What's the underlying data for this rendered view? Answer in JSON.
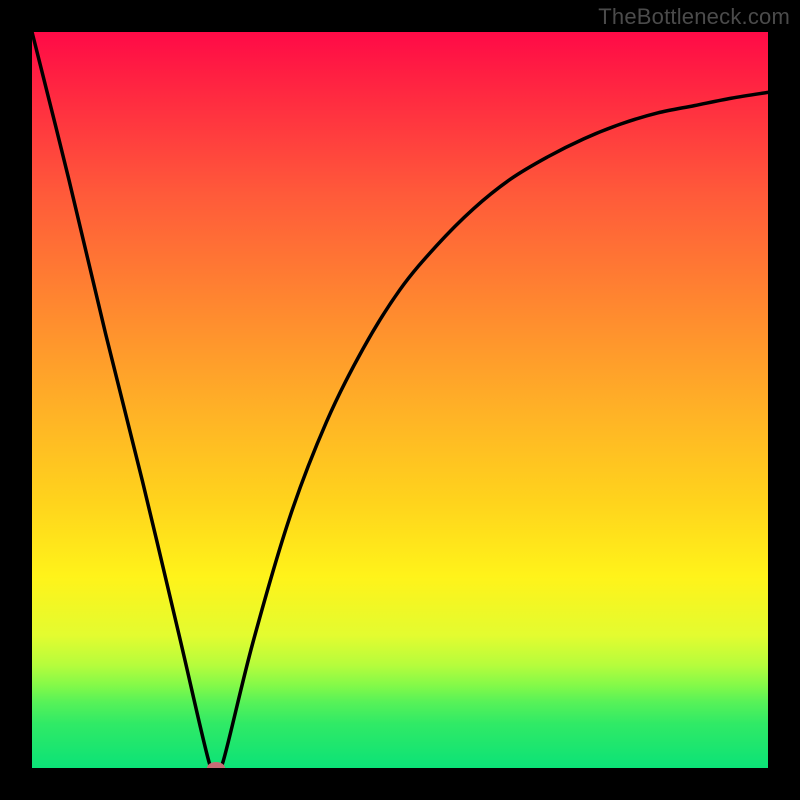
{
  "watermark": "TheBottleneck.com",
  "chart_data": {
    "type": "line",
    "title": "",
    "xlabel": "",
    "ylabel": "",
    "xlim": [
      0,
      100
    ],
    "ylim": [
      0,
      100
    ],
    "grid": false,
    "legend": false,
    "series": [
      {
        "name": "curve",
        "x": [
          0,
          5,
          10,
          15,
          20,
          24,
          25,
          26,
          30,
          35,
          40,
          45,
          50,
          55,
          60,
          65,
          70,
          75,
          80,
          85,
          90,
          95,
          100
        ],
        "y": [
          100,
          80,
          59,
          39,
          18,
          1,
          0,
          1,
          17,
          34,
          47,
          57,
          65,
          71,
          76,
          80,
          83,
          85.5,
          87.5,
          89,
          90,
          91,
          91.8
        ]
      }
    ],
    "marker": {
      "x": 25,
      "y": 0,
      "color": "#c76d76",
      "rx": 9,
      "ry": 6
    }
  },
  "colors": {
    "curve_stroke": "#000000",
    "frame_bg": "#000000"
  }
}
